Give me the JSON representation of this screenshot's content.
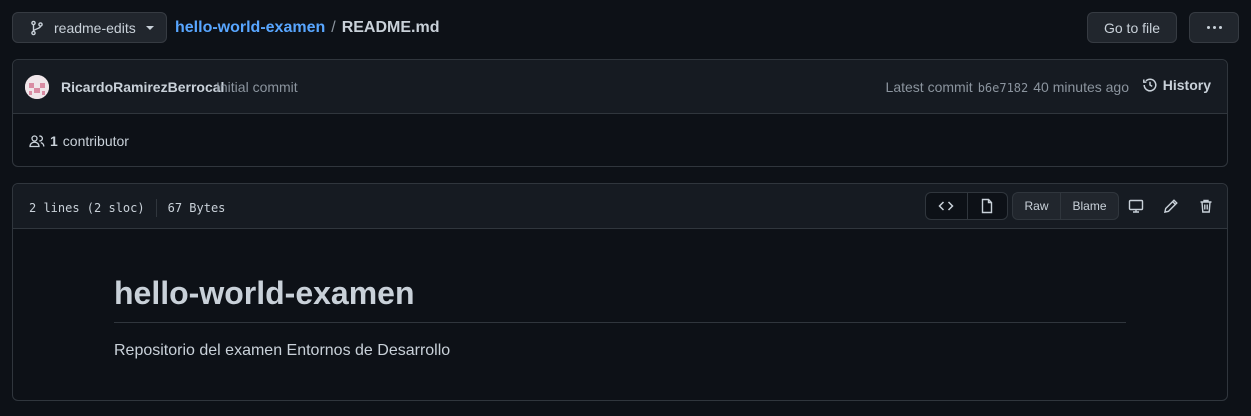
{
  "branch": {
    "name": "readme-edits"
  },
  "breadcrumb": {
    "repo": "hello-world-examen",
    "separator": "/",
    "file": "README.md"
  },
  "actions": {
    "goto_file": "Go to file"
  },
  "commit": {
    "author": "RicardoRamirezBerrocal",
    "message": "Initial commit",
    "latest_label": "Latest commit",
    "sha": "b6e7182",
    "time": "40 minutes ago",
    "history_label": "History"
  },
  "contributors": {
    "count": "1",
    "label": "contributor"
  },
  "file": {
    "lines": "2 lines (2 sloc)",
    "size": "67 Bytes",
    "raw_label": "Raw",
    "blame_label": "Blame"
  },
  "readme": {
    "heading": "hello-world-examen",
    "body": "Repositorio del examen Entornos de Desarrollo"
  },
  "icons": {
    "branch": "git-branch-icon",
    "history": "history-icon",
    "people": "people-icon",
    "code": "code-icon",
    "file": "file-icon",
    "desktop": "desktop-icon",
    "edit": "pencil-icon",
    "trash": "trash-icon",
    "more": "kebab-horizontal-icon"
  },
  "colors": {
    "link": "#58a6ff",
    "background": "#0d1117",
    "surface": "#161b22",
    "border": "#30363d"
  }
}
